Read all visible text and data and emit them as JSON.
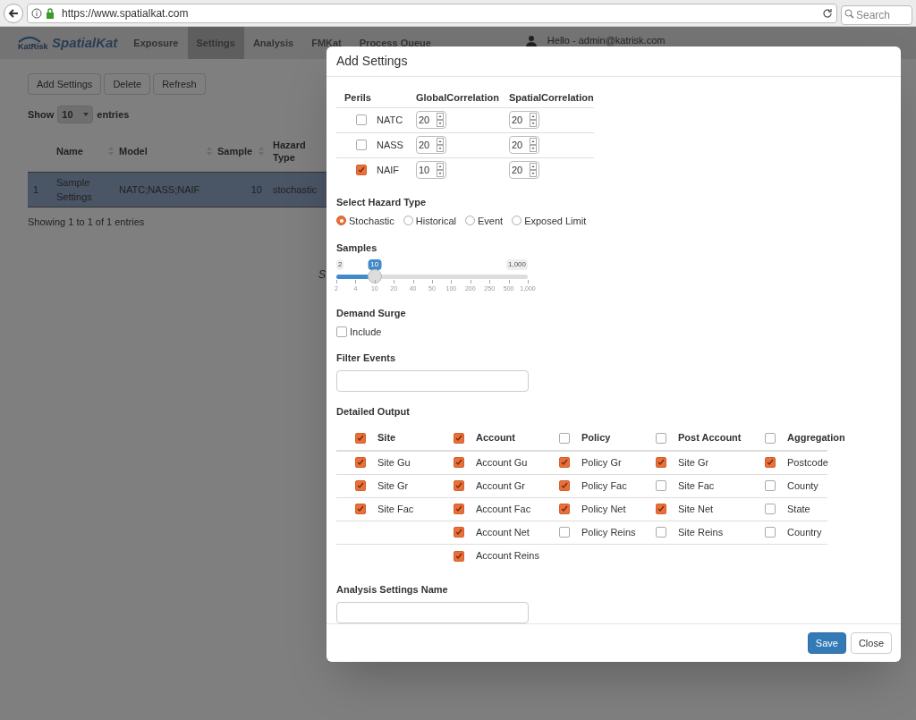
{
  "browser": {
    "url": "https://www.spatialkat.com",
    "search_placeholder": "Search"
  },
  "nav": {
    "logo_text": "KatRisk",
    "brand": "SpatialKat",
    "items": [
      {
        "label": "Exposure",
        "selected": false
      },
      {
        "label": "Settings",
        "selected": true
      },
      {
        "label": "Analysis",
        "selected": false
      },
      {
        "label": "FMKat",
        "selected": false
      },
      {
        "label": "Process Queue",
        "selected": false
      }
    ],
    "user": "Hello - admin@katrisk.com"
  },
  "toolbar": [
    "Add Settings",
    "Delete",
    "Refresh"
  ],
  "length": {
    "show": "Show",
    "value": "10",
    "entries": "entries"
  },
  "table": {
    "columns": [
      "Name",
      "Model",
      "Sample",
      "Hazard Type"
    ],
    "rows": [
      {
        "index": "1",
        "cells": [
          "Sample Settings",
          "NATC;NASS;NAIF",
          "10",
          "stochastic"
        ],
        "selected": true
      }
    ]
  },
  "info": "Showing 1 to 1 of 1 entries",
  "hidden_text": "S",
  "modal": {
    "title": "Add Settings",
    "perils": {
      "columns": [
        "Perils",
        "GlobalCorrelation",
        "SpatialCorrelation"
      ],
      "rows": [
        {
          "name": "NATC",
          "checked": false,
          "global": "20",
          "spatial": "20"
        },
        {
          "name": "NASS",
          "checked": false,
          "global": "20",
          "spatial": "20"
        },
        {
          "name": "NAIF",
          "checked": true,
          "global": "10",
          "spatial": "20"
        }
      ]
    },
    "hazard": {
      "label": "Select Hazard Type",
      "options": [
        {
          "label": "Stochastic",
          "selected": true
        },
        {
          "label": "Historical",
          "selected": false
        },
        {
          "label": "Event",
          "selected": false
        },
        {
          "label": "Exposed Limit",
          "selected": false
        }
      ]
    },
    "samples": {
      "label": "Samples",
      "min": "2",
      "value": "10",
      "max": "1,000",
      "level": 0.2,
      "ticks": [
        "2",
        "4",
        "10",
        "20",
        "40",
        "50",
        "100",
        "200",
        "250",
        "500",
        "1,000"
      ]
    },
    "demand_surge": {
      "label": "Demand Surge",
      "option": "Include",
      "checked": false
    },
    "filter": {
      "label": "Filter Events"
    },
    "detailed": {
      "label": "Detailed Output",
      "columns": [
        {
          "title": "Site",
          "checked": true,
          "items": [
            {
              "label": "Site Gu",
              "checked": true
            },
            {
              "label": "Site Gr",
              "checked": true
            },
            {
              "label": "Site Fac",
              "checked": true
            }
          ]
        },
        {
          "title": "Account",
          "checked": true,
          "items": [
            {
              "label": "Account Gu",
              "checked": true
            },
            {
              "label": "Account Gr",
              "checked": true
            },
            {
              "label": "Account Fac",
              "checked": true
            },
            {
              "label": "Account Net",
              "checked": true
            },
            {
              "label": "Account Reins",
              "checked": true
            }
          ]
        },
        {
          "title": "Policy",
          "checked": false,
          "items": [
            {
              "label": "Policy Gr",
              "checked": true
            },
            {
              "label": "Policy Fac",
              "checked": true
            },
            {
              "label": "Policy Net",
              "checked": true
            },
            {
              "label": "Policy Reins",
              "checked": false
            }
          ]
        },
        {
          "title": "Post Account",
          "checked": false,
          "items": [
            {
              "label": "Site Gr",
              "checked": true
            },
            {
              "label": "Site Fac",
              "checked": false
            },
            {
              "label": "Site Net",
              "checked": true
            },
            {
              "label": "Site Reins",
              "checked": false
            }
          ]
        },
        {
          "title": "Aggregation",
          "checked": false,
          "items": [
            {
              "label": "Postcode",
              "checked": true
            },
            {
              "label": "County",
              "checked": false
            },
            {
              "label": "State",
              "checked": false
            },
            {
              "label": "Country",
              "checked": false
            }
          ]
        }
      ]
    },
    "name_field": {
      "label": "Analysis Settings Name"
    },
    "buttons": [
      {
        "label": "Save",
        "kind": "primary"
      },
      {
        "label": "Close",
        "kind": "default"
      }
    ]
  }
}
